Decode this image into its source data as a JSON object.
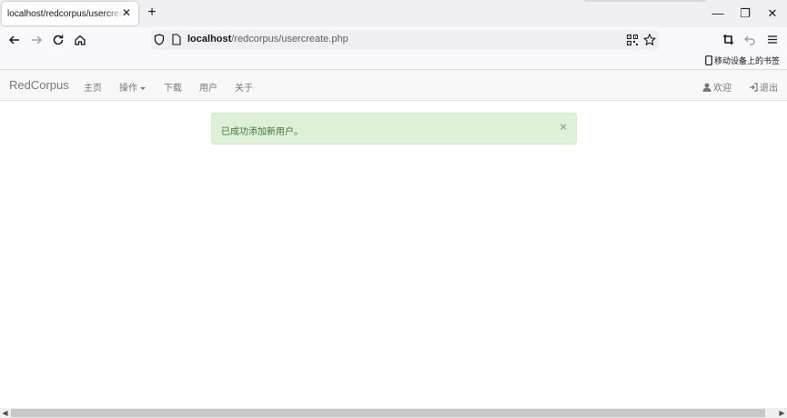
{
  "browser": {
    "tab_title": "localhost/redcorpus/usercreate.php",
    "tab_close": "✕",
    "new_tab": "+",
    "url_host": "localhost",
    "url_path": "/redcorpus/usercreate.php",
    "bookmark_label": "移动设备上的书签",
    "window_controls": {
      "minimize": "—",
      "restore": "❐",
      "close": "✕"
    }
  },
  "navbar": {
    "brand": "RedCorpus",
    "links": [
      {
        "label": "主页"
      },
      {
        "label": "操作"
      },
      {
        "label": "下载"
      },
      {
        "label": "用户"
      },
      {
        "label": "关于"
      }
    ],
    "welcome": "欢迎",
    "logout": "退出"
  },
  "alert": {
    "message": "已成功添加新用户。",
    "close": "×"
  },
  "scrollbar": {
    "left_arrow": "◀",
    "right_arrow": "▶"
  },
  "colors": {
    "alert_bg": "#dff0d8",
    "alert_text": "#3c763d",
    "navbar_bg": "#f8f8f8",
    "nav_text": "#777777"
  },
  "icons": {
    "back": "arrow-left-icon",
    "forward": "arrow-right-icon",
    "reload": "reload-icon",
    "home": "home-icon",
    "shield": "shield-icon",
    "page": "page-icon",
    "qr": "qr-code-icon",
    "bookmark_star": "star-icon",
    "extensions": "crop-icon",
    "undo": "undo-icon",
    "menu": "hamburger-menu-icon",
    "mobile": "mobile-device-icon",
    "user": "user-icon",
    "logout": "logout-icon"
  }
}
